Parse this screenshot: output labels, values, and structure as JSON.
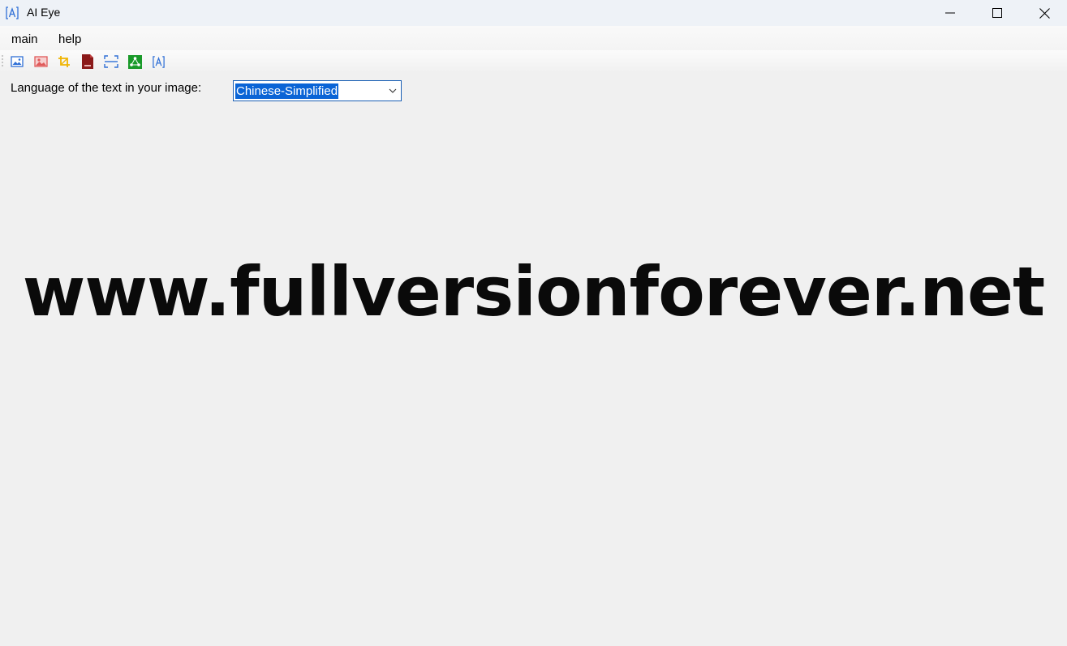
{
  "window": {
    "title": "AI Eye",
    "app_icon_glyph": "[A]",
    "controls": [
      "minimize-icon",
      "maximize-icon",
      "close-icon"
    ]
  },
  "menu": {
    "items": [
      {
        "label": "main"
      },
      {
        "label": "help"
      }
    ]
  },
  "toolbar": {
    "buttons": [
      {
        "icon": "image-icon",
        "color": "#2f6fd6"
      },
      {
        "icon": "photo-icon",
        "color": "#e05a5a"
      },
      {
        "icon": "crop-icon",
        "color": "#f0b400"
      },
      {
        "icon": "pdf-icon",
        "color": "#8b1a1a"
      },
      {
        "icon": "screen-capture-icon",
        "color": "#2f6fd6"
      },
      {
        "icon": "share-icon",
        "color": "#1a9a2a"
      },
      {
        "icon": "ocr-icon",
        "color": "#2f6fd6"
      }
    ]
  },
  "language": {
    "label": "Language of the text in your image:",
    "selected": "Chinese-Simplified"
  },
  "image": {
    "text": "www.fullversionforever.net"
  }
}
